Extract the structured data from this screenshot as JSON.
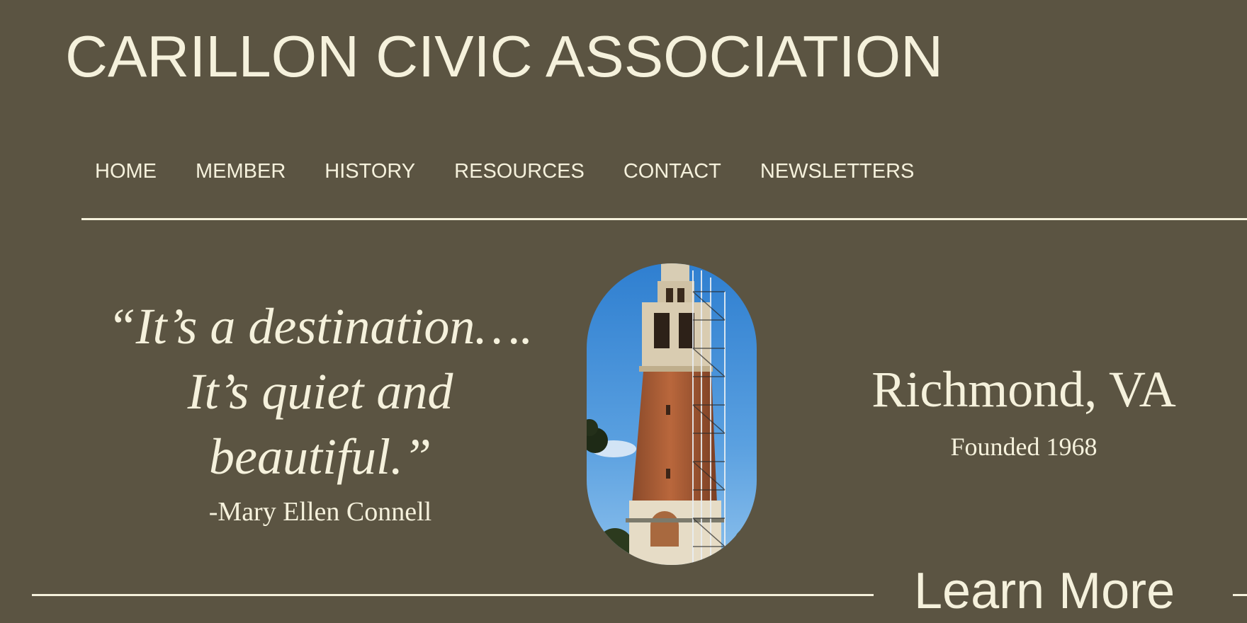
{
  "site": {
    "title": "CARILLON CIVIC ASSOCIATION"
  },
  "nav": {
    "items": [
      {
        "label": "HOME"
      },
      {
        "label": "MEMBER"
      },
      {
        "label": "HISTORY"
      },
      {
        "label": "RESOURCES"
      },
      {
        "label": "CONTACT"
      },
      {
        "label": "NEWSLETTERS"
      }
    ]
  },
  "hero": {
    "quote_lines": [
      "“It’s a destination….",
      "It’s quiet and",
      "beautiful.”"
    ],
    "attribution": "-Mary Ellen Connell",
    "image_subject": "carillon-tower-photo",
    "location": "Richmond, VA",
    "founded": "Founded 1968",
    "cta_label": "Learn More"
  },
  "colors": {
    "background": "#5b5442",
    "text": "#f5f1dc"
  }
}
